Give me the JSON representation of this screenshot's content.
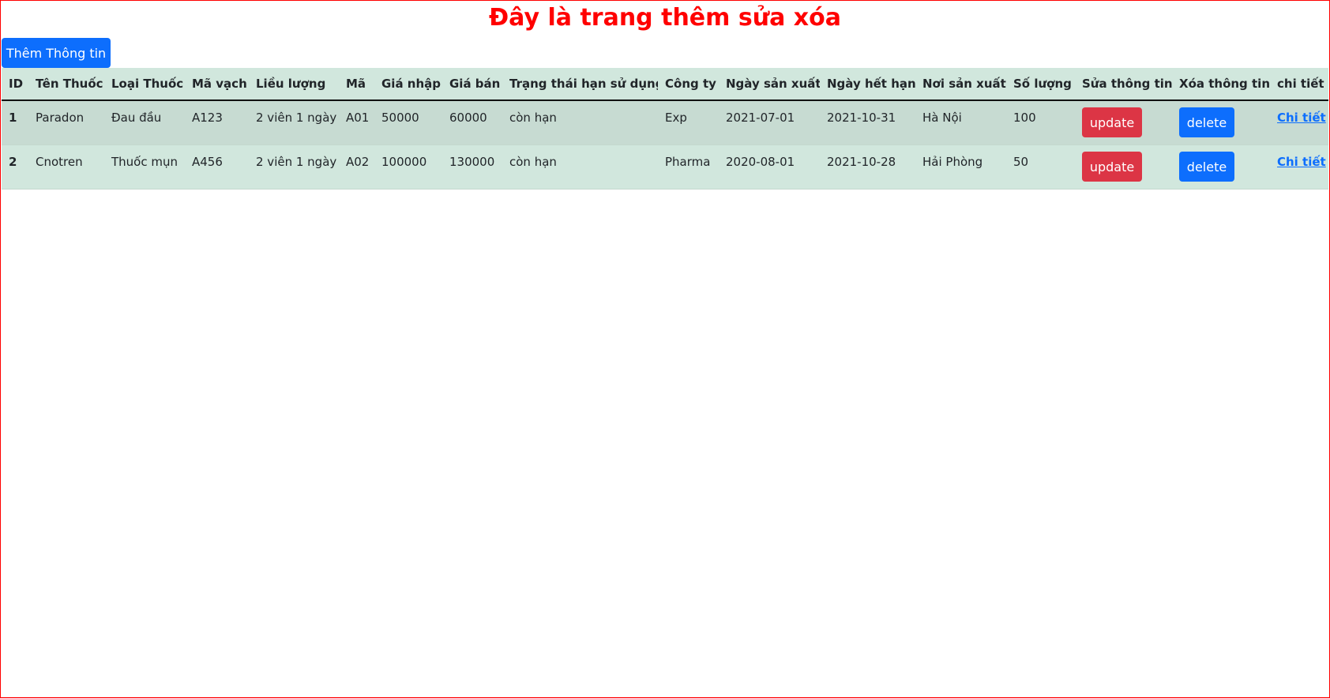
{
  "page_title": "Đây là trang thêm sửa xóa",
  "add_button_label": "Thêm Thông tin",
  "table": {
    "headers": [
      "ID",
      "Tên Thuốc",
      "Loại Thuốc",
      "Mã vạch",
      "Liều lượng",
      "Mã",
      "Giá nhập",
      "Giá bán",
      "Trạng thái hạn sử dụng",
      "Công ty",
      "Ngày sản xuất",
      "Ngày hết hạn",
      "Nơi sản xuất",
      "Số lượng",
      "Sửa thông tin",
      "Xóa thông tin",
      "chi tiết"
    ],
    "rows": [
      {
        "id": "1",
        "ten_thuoc": "Paradon",
        "loai_thuoc": "Đau đầu",
        "ma_vach": "A123",
        "lieu_luong": "2 viên 1 ngày",
        "ma": "A01",
        "gia_nhap": "50000",
        "gia_ban": "60000",
        "trang_thai": "còn hạn",
        "cong_ty": "Exp",
        "ngay_san_xuat": "2021-07-01",
        "ngay_het_han": "2021-10-31",
        "noi_san_xuat": "Hà Nội",
        "so_luong": "100",
        "update_label": "update",
        "delete_label": "delete",
        "detail_label": "Chi tiết"
      },
      {
        "id": "2",
        "ten_thuoc": "Cnotren",
        "loai_thuoc": "Thuốc mụn",
        "ma_vach": "A456",
        "lieu_luong": "2 viên 1 ngày",
        "ma": "A02",
        "gia_nhap": "100000",
        "gia_ban": "130000",
        "trang_thai": "còn hạn",
        "cong_ty": "Pharma",
        "ngay_san_xuat": "2020-08-01",
        "ngay_het_han": "2021-10-28",
        "noi_san_xuat": "Hải Phòng",
        "so_luong": "50",
        "update_label": "update",
        "delete_label": "delete",
        "detail_label": "Chi tiết"
      }
    ]
  },
  "colors": {
    "title": "#ff0000",
    "frame_border": "#ff0000",
    "primary_button": "#0d6efd",
    "danger_button": "#dc3545",
    "table_row_odd": "#c7dbd2",
    "table_row_even": "#d1e7dd",
    "link": "#0d6efd"
  }
}
